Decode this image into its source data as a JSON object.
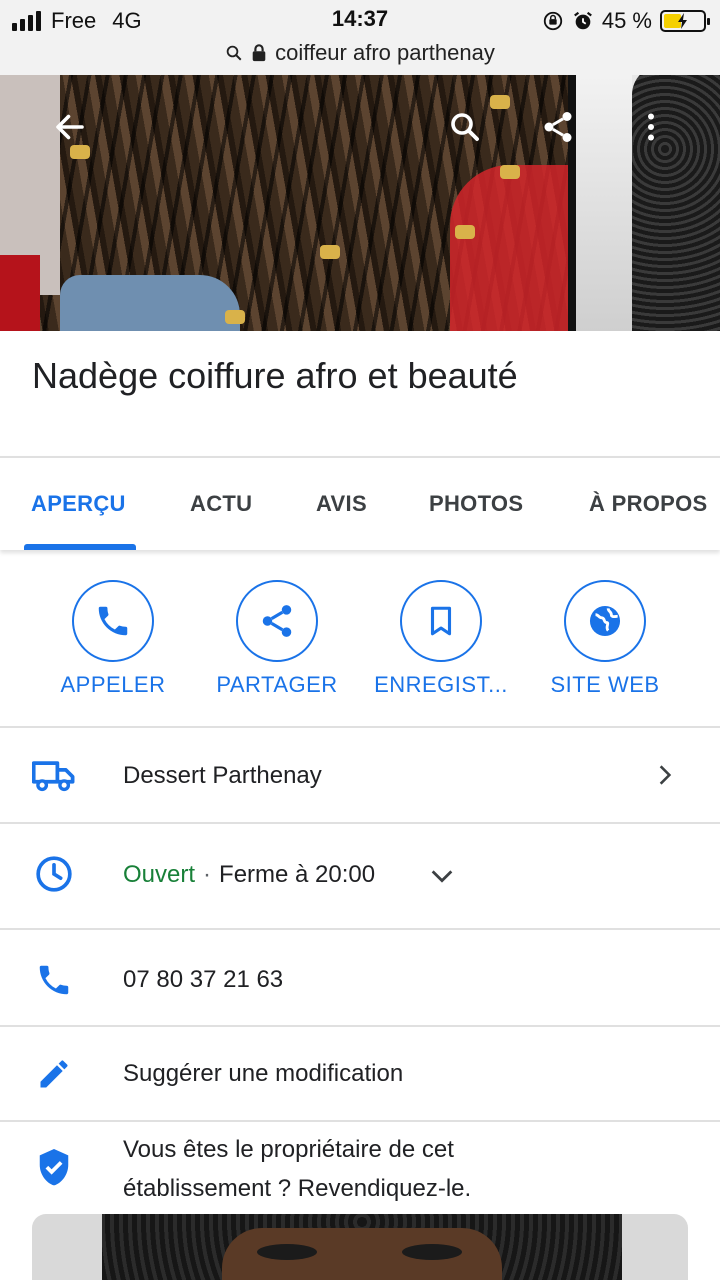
{
  "status_bar": {
    "carrier": "Free",
    "network": "4G",
    "time": "14:37",
    "battery": "45 %",
    "battery_level": 0.45
  },
  "url_bar": {
    "url": "coiffeur afro parthenay"
  },
  "place": {
    "name": "Nadège coiffure afro et beauté"
  },
  "tabs": [
    {
      "label": "APERÇU",
      "active": true
    },
    {
      "label": "ACTU",
      "active": false
    },
    {
      "label": "AVIS",
      "active": false
    },
    {
      "label": "PHOTOS",
      "active": false
    },
    {
      "label": "À PROPOS",
      "active": false
    }
  ],
  "actions": [
    {
      "label": "APPELER",
      "icon": "phone-icon"
    },
    {
      "label": "PARTAGER",
      "icon": "share-icon"
    },
    {
      "label": "ENREGIST...",
      "icon": "bookmark-icon"
    },
    {
      "label": "SITE WEB",
      "icon": "globe-icon"
    }
  ],
  "info": {
    "delivery": "Dessert Parthenay",
    "hours_status": "Ouvert",
    "hours_sep": "·",
    "hours_detail": "Ferme à 20:00",
    "phone": "07 80 37 21 63",
    "suggest": "Suggérer une modification",
    "claim_line1": "Vous êtes le propriétaire de cet",
    "claim_line2": "établissement ? Revendiquez-le."
  },
  "colors": {
    "accent": "#1a73e8",
    "open": "#188038",
    "text": "#202124",
    "divider": "#e0e0e0"
  }
}
